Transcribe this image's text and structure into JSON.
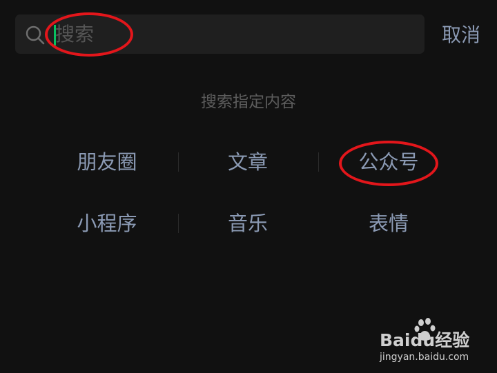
{
  "search": {
    "value": "",
    "placeholder": "搜索",
    "cancel_label": "取消"
  },
  "section_title": "搜索指定内容",
  "categories": [
    {
      "label": "朋友圈"
    },
    {
      "label": "文章"
    },
    {
      "label": "公众号"
    },
    {
      "label": "小程序"
    },
    {
      "label": "音乐"
    },
    {
      "label": "表情"
    }
  ],
  "colors": {
    "background": "#111111",
    "search_bg": "#1f1f1f",
    "link_text": "#8b9ab4",
    "hint_text": "#5c5c5c",
    "cursor": "#07c160",
    "annotation": "#e3161b"
  },
  "watermark": {
    "brand": "Baidu经验",
    "url": "jingyan.baidu.com"
  }
}
